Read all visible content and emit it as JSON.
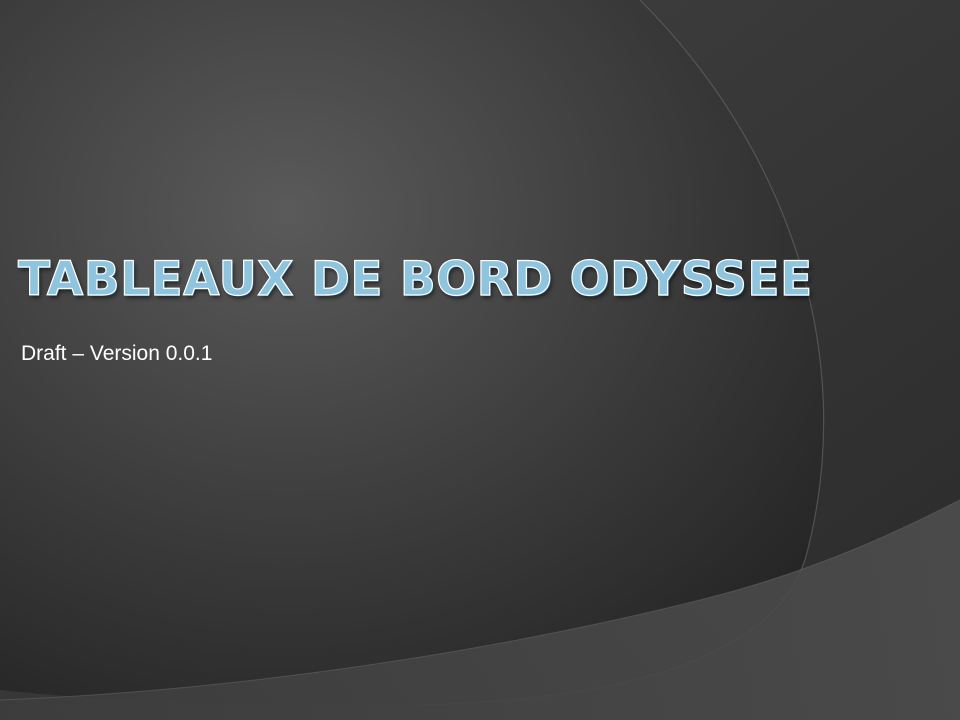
{
  "slide": {
    "title": "Tableaux de bord ODYSSEE",
    "subtitle": "Draft – Version 0.0.1"
  },
  "colors": {
    "title_fill": "#8fc4de",
    "title_outline": "#ffffff",
    "background_light": "#5e5e5e",
    "background_dark": "#2e2e2e"
  }
}
